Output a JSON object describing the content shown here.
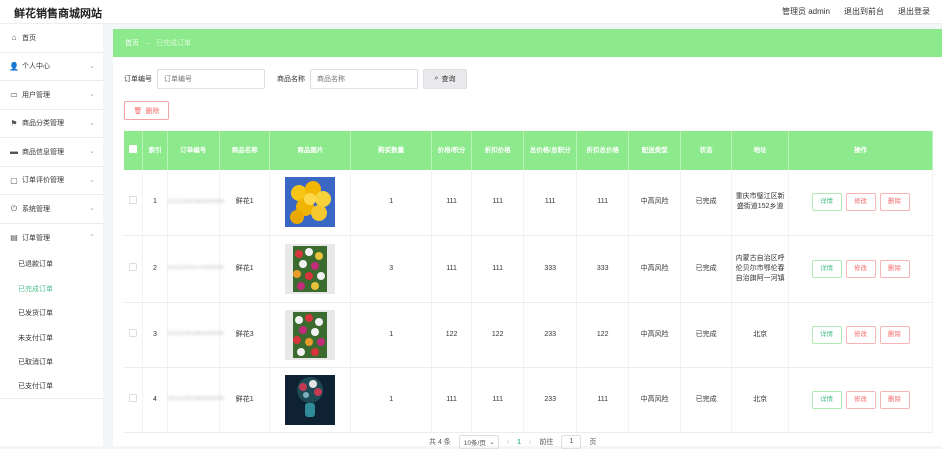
{
  "header": {
    "site_title": "鲜花销售商城网站",
    "admin": "管理员 admin",
    "back_frontend": "退出到前台",
    "logout": "退出登录"
  },
  "sidebar": {
    "items": [
      {
        "label": "首页",
        "icon": "home-icon"
      },
      {
        "label": "个人中心",
        "icon": "user-icon"
      },
      {
        "label": "用户管理",
        "icon": "chat-icon"
      },
      {
        "label": "商品分类管理",
        "icon": "flag-icon"
      },
      {
        "label": "商品信息管理",
        "icon": "box-icon"
      },
      {
        "label": "订单评价管理",
        "icon": "comment-icon"
      },
      {
        "label": "系统管理",
        "icon": "power-icon"
      },
      {
        "label": "订单管理",
        "icon": "order-icon"
      }
    ],
    "sub_items": [
      "已退款订单",
      "已完成订单",
      "已发货订单",
      "未支付订单",
      "已取消订单",
      "已支付订单"
    ],
    "active_sub": "已完成订单"
  },
  "breadcrumb": {
    "home": "首页",
    "arrow": "→",
    "current": "已完成订单"
  },
  "search": {
    "order_label": "订单编号",
    "order_placeholder": "订单编号",
    "product_label": "商品名称",
    "product_placeholder": "商品名称",
    "button": "查询"
  },
  "delete_button": "删除",
  "table": {
    "headers": [
      "索引",
      "订单编号",
      "商品名称",
      "商品图片",
      "购买数量",
      "价格/积分",
      "折扣价格",
      "总价格/总积分",
      "折扣总价格",
      "配送类型",
      "状态",
      "地址",
      "操作"
    ],
    "rows": [
      {
        "index": "1",
        "order_no": "20221001082000000",
        "name": "鲜花1",
        "qty": "1",
        "price": "111",
        "discount": "111",
        "total": "111",
        "discount_total": "111",
        "delivery": "中高风险",
        "status": "已完成",
        "address": "重庆市璧江区新盛街道152乡道"
      },
      {
        "index": "2",
        "order_no": "20221001075000000",
        "name": "鲜花1",
        "qty": "3",
        "price": "111",
        "discount": "111",
        "total": "333",
        "discount_total": "333",
        "delivery": "中高风险",
        "status": "已完成",
        "address": "内蒙古自治区呼伦贝尔市鄂伦春自治旗阿一河镇"
      },
      {
        "index": "3",
        "order_no": "20221001082000000",
        "name": "鲜花3",
        "qty": "1",
        "price": "122",
        "discount": "122",
        "total": "233",
        "discount_total": "122",
        "delivery": "中高风险",
        "status": "已完成",
        "address": "北京"
      },
      {
        "index": "4",
        "order_no": "20221001082000000",
        "name": "鲜花1",
        "qty": "1",
        "price": "111",
        "discount": "111",
        "total": "233",
        "discount_total": "111",
        "delivery": "中高风险",
        "status": "已完成",
        "address": "北京"
      }
    ],
    "ops": {
      "detail": "详情",
      "edit": "修改",
      "delete": "删除"
    }
  },
  "pager": {
    "total": "共 4 条",
    "size": "10条/页",
    "page": "1",
    "goto": "前往",
    "goto_value": "1",
    "unit": "页"
  }
}
